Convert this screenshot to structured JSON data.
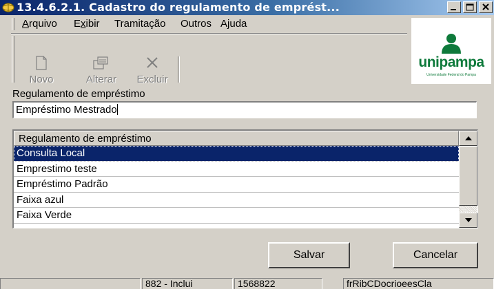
{
  "window": {
    "title": "13.4.6.2.1. Cadastro do regulamento de empréstimo",
    "title_display": "13.4.6.2.1. Cadastro do regulamento de emprést...",
    "controls": [
      "minimize-icon",
      "maximize-icon",
      "close-icon"
    ]
  },
  "menu": {
    "items": [
      {
        "label": "Arquivo",
        "mnemonic": "A"
      },
      {
        "label": "Exibir",
        "mnemonic": "x"
      },
      {
        "label": "Tramitação",
        "mnemonic": ""
      },
      {
        "label": "Outros",
        "mnemonic": ""
      },
      {
        "label": "Ajuda",
        "mnemonic": "j"
      }
    ]
  },
  "toolbar": {
    "buttons": [
      {
        "label": "Novo",
        "icon": "new-document-icon",
        "enabled": false
      },
      {
        "label": "Alterar",
        "icon": "edit-icon",
        "enabled": false
      },
      {
        "label": "Excluir",
        "icon": "delete-icon",
        "enabled": false
      }
    ]
  },
  "logo": {
    "name": "unipampa",
    "subtitle": "Universidade Federal do Pampa",
    "color": "#0e7a3b"
  },
  "form": {
    "field_label": "Regulamento de empréstimo",
    "field_value": "Empréstimo Mestrado"
  },
  "list": {
    "header": "Regulamento de empréstimo",
    "rows": [
      {
        "label": "Consulta Local",
        "selected": true
      },
      {
        "label": "Emprestimo teste",
        "selected": false
      },
      {
        "label": "Empréstimo Padrão",
        "selected": false
      },
      {
        "label": "Faixa azul",
        "selected": false
      },
      {
        "label": "Faixa Verde",
        "selected": false
      },
      {
        "label": "",
        "selected": false
      }
    ]
  },
  "buttons": {
    "save": "Salvar",
    "cancel": "Cancelar"
  },
  "status": {
    "panels": [
      "",
      "882 - Inclui",
      "1568822",
      "frRibCDocrioeesCla"
    ]
  },
  "colors": {
    "titlebar_start": "#0a246a",
    "selection": "#0a246a",
    "face": "#d4d0c8"
  }
}
